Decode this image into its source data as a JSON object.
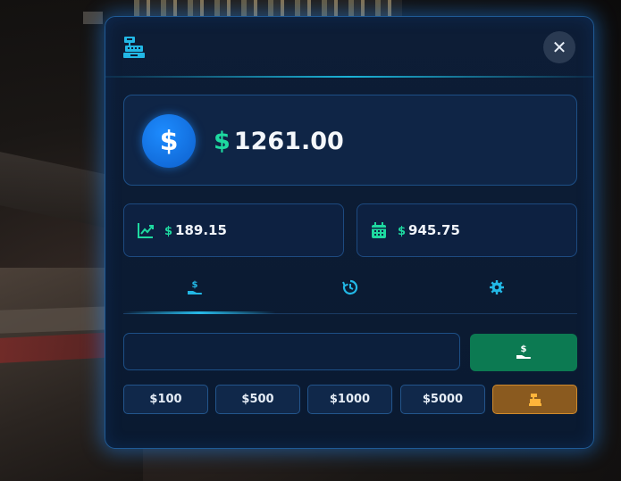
{
  "balance": {
    "currency_symbol": "$",
    "amount": "1261.00"
  },
  "stats": [
    {
      "icon": "trend-chart-icon",
      "currency_symbol": "$",
      "value": "189.15"
    },
    {
      "icon": "calendar-icon",
      "currency_symbol": "$",
      "value": "945.75"
    }
  ],
  "tabs": [
    {
      "icon": "deposit-hand-icon",
      "active": true
    },
    {
      "icon": "history-icon",
      "active": false
    },
    {
      "icon": "gear-icon",
      "active": false
    }
  ],
  "input": {
    "value": "",
    "placeholder": ""
  },
  "quick_amounts": [
    "$100",
    "$500",
    "$1000",
    "$5000"
  ],
  "close_label": "✕",
  "colors": {
    "accent": "#1ed9a0",
    "primary_blue": "#1d8cff",
    "deposit_green": "#0c7a52",
    "max_orange": "#d08a2c",
    "panel_bg": "#0d1d36",
    "icon_cyan": "#22b8e6"
  }
}
